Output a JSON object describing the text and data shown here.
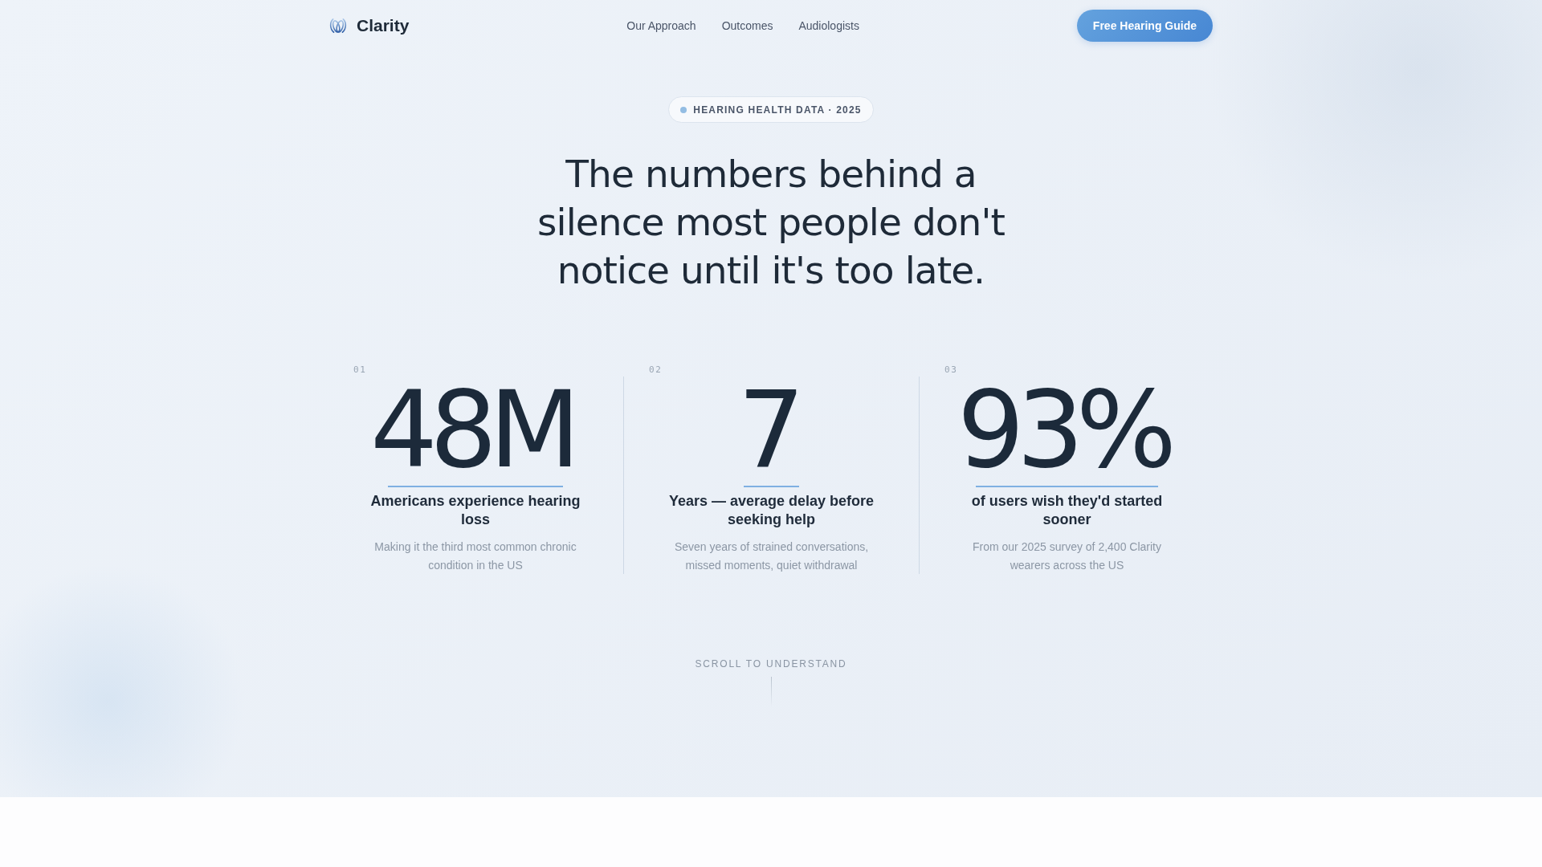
{
  "nav": {
    "brand": "Clarity",
    "links": [
      "Our Approach",
      "Outcomes",
      "Audiologists"
    ],
    "cta": "Free Hearing Guide"
  },
  "hero": {
    "badge": "HEARING HEALTH DATA · 2025",
    "heading": "The numbers behind a silence most people don't notice until it's too late."
  },
  "stats": [
    {
      "index": "01",
      "value": "48M",
      "label": "Americans experience hearing loss",
      "description": "Making it the third most common chronic condition in the US"
    },
    {
      "index": "02",
      "value": "7",
      "label": "Years — average delay before seeking help",
      "description": "Seven years of strained conversations, missed moments, quiet withdrawal"
    },
    {
      "index": "03",
      "value": "93%",
      "label": "of users wish they'd started sooner",
      "description": "From our 2025 survey of 2,400 Clarity wearers across the US"
    }
  ],
  "scroll_hint": "SCROLL TO UNDERSTAND"
}
